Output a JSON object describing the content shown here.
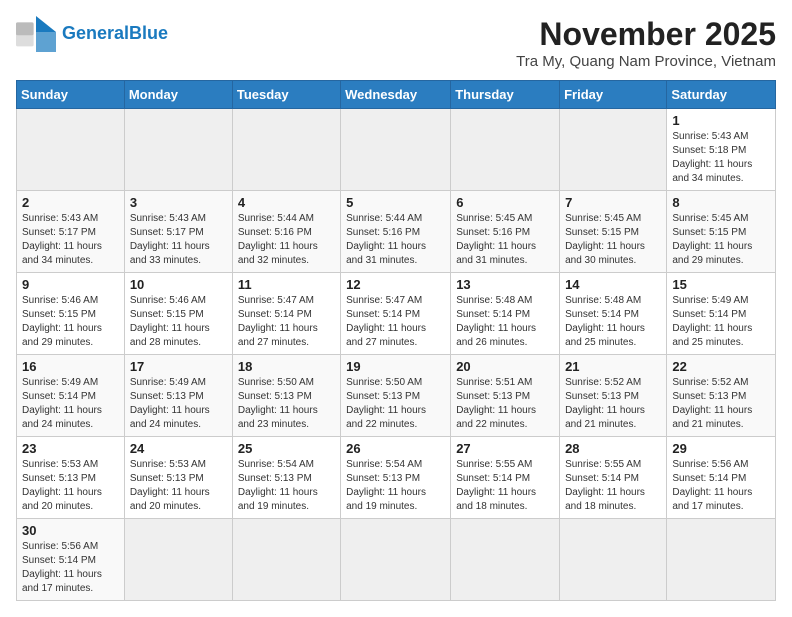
{
  "header": {
    "logo_general": "General",
    "logo_blue": "Blue",
    "month_title": "November 2025",
    "subtitle": "Tra My, Quang Nam Province, Vietnam"
  },
  "weekdays": [
    "Sunday",
    "Monday",
    "Tuesday",
    "Wednesday",
    "Thursday",
    "Friday",
    "Saturday"
  ],
  "weeks": [
    [
      {
        "day": "",
        "info": ""
      },
      {
        "day": "",
        "info": ""
      },
      {
        "day": "",
        "info": ""
      },
      {
        "day": "",
        "info": ""
      },
      {
        "day": "",
        "info": ""
      },
      {
        "day": "",
        "info": ""
      },
      {
        "day": "1",
        "info": "Sunrise: 5:43 AM\nSunset: 5:18 PM\nDaylight: 11 hours\nand 34 minutes."
      }
    ],
    [
      {
        "day": "2",
        "info": "Sunrise: 5:43 AM\nSunset: 5:17 PM\nDaylight: 11 hours\nand 34 minutes."
      },
      {
        "day": "3",
        "info": "Sunrise: 5:43 AM\nSunset: 5:17 PM\nDaylight: 11 hours\nand 33 minutes."
      },
      {
        "day": "4",
        "info": "Sunrise: 5:44 AM\nSunset: 5:16 PM\nDaylight: 11 hours\nand 32 minutes."
      },
      {
        "day": "5",
        "info": "Sunrise: 5:44 AM\nSunset: 5:16 PM\nDaylight: 11 hours\nand 31 minutes."
      },
      {
        "day": "6",
        "info": "Sunrise: 5:45 AM\nSunset: 5:16 PM\nDaylight: 11 hours\nand 31 minutes."
      },
      {
        "day": "7",
        "info": "Sunrise: 5:45 AM\nSunset: 5:15 PM\nDaylight: 11 hours\nand 30 minutes."
      },
      {
        "day": "8",
        "info": "Sunrise: 5:45 AM\nSunset: 5:15 PM\nDaylight: 11 hours\nand 29 minutes."
      }
    ],
    [
      {
        "day": "9",
        "info": "Sunrise: 5:46 AM\nSunset: 5:15 PM\nDaylight: 11 hours\nand 29 minutes."
      },
      {
        "day": "10",
        "info": "Sunrise: 5:46 AM\nSunset: 5:15 PM\nDaylight: 11 hours\nand 28 minutes."
      },
      {
        "day": "11",
        "info": "Sunrise: 5:47 AM\nSunset: 5:14 PM\nDaylight: 11 hours\nand 27 minutes."
      },
      {
        "day": "12",
        "info": "Sunrise: 5:47 AM\nSunset: 5:14 PM\nDaylight: 11 hours\nand 27 minutes."
      },
      {
        "day": "13",
        "info": "Sunrise: 5:48 AM\nSunset: 5:14 PM\nDaylight: 11 hours\nand 26 minutes."
      },
      {
        "day": "14",
        "info": "Sunrise: 5:48 AM\nSunset: 5:14 PM\nDaylight: 11 hours\nand 25 minutes."
      },
      {
        "day": "15",
        "info": "Sunrise: 5:49 AM\nSunset: 5:14 PM\nDaylight: 11 hours\nand 25 minutes."
      }
    ],
    [
      {
        "day": "16",
        "info": "Sunrise: 5:49 AM\nSunset: 5:14 PM\nDaylight: 11 hours\nand 24 minutes."
      },
      {
        "day": "17",
        "info": "Sunrise: 5:49 AM\nSunset: 5:13 PM\nDaylight: 11 hours\nand 24 minutes."
      },
      {
        "day": "18",
        "info": "Sunrise: 5:50 AM\nSunset: 5:13 PM\nDaylight: 11 hours\nand 23 minutes."
      },
      {
        "day": "19",
        "info": "Sunrise: 5:50 AM\nSunset: 5:13 PM\nDaylight: 11 hours\nand 22 minutes."
      },
      {
        "day": "20",
        "info": "Sunrise: 5:51 AM\nSunset: 5:13 PM\nDaylight: 11 hours\nand 22 minutes."
      },
      {
        "day": "21",
        "info": "Sunrise: 5:52 AM\nSunset: 5:13 PM\nDaylight: 11 hours\nand 21 minutes."
      },
      {
        "day": "22",
        "info": "Sunrise: 5:52 AM\nSunset: 5:13 PM\nDaylight: 11 hours\nand 21 minutes."
      }
    ],
    [
      {
        "day": "23",
        "info": "Sunrise: 5:53 AM\nSunset: 5:13 PM\nDaylight: 11 hours\nand 20 minutes."
      },
      {
        "day": "24",
        "info": "Sunrise: 5:53 AM\nSunset: 5:13 PM\nDaylight: 11 hours\nand 20 minutes."
      },
      {
        "day": "25",
        "info": "Sunrise: 5:54 AM\nSunset: 5:13 PM\nDaylight: 11 hours\nand 19 minutes."
      },
      {
        "day": "26",
        "info": "Sunrise: 5:54 AM\nSunset: 5:13 PM\nDaylight: 11 hours\nand 19 minutes."
      },
      {
        "day": "27",
        "info": "Sunrise: 5:55 AM\nSunset: 5:14 PM\nDaylight: 11 hours\nand 18 minutes."
      },
      {
        "day": "28",
        "info": "Sunrise: 5:55 AM\nSunset: 5:14 PM\nDaylight: 11 hours\nand 18 minutes."
      },
      {
        "day": "29",
        "info": "Sunrise: 5:56 AM\nSunset: 5:14 PM\nDaylight: 11 hours\nand 17 minutes."
      }
    ],
    [
      {
        "day": "30",
        "info": "Sunrise: 5:56 AM\nSunset: 5:14 PM\nDaylight: 11 hours\nand 17 minutes."
      },
      {
        "day": "",
        "info": ""
      },
      {
        "day": "",
        "info": ""
      },
      {
        "day": "",
        "info": ""
      },
      {
        "day": "",
        "info": ""
      },
      {
        "day": "",
        "info": ""
      },
      {
        "day": "",
        "info": ""
      }
    ]
  ]
}
